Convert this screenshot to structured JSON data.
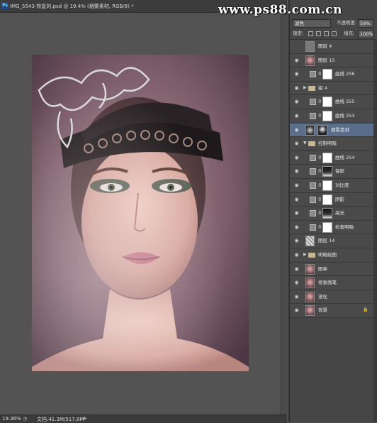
{
  "document": {
    "badge": "Ps",
    "tab_title": "IMG_5543-恢复的.psd @ 19.4% (烟雾素材, RGB/8) *",
    "tab_close": "×"
  },
  "status": {
    "zoom": "19.36%",
    "doc_info": "文档:41.3M/517.8M",
    "info_glyph": "◔",
    "arrow_glyph": "▶"
  },
  "watermark": "www.ps88.com.cn",
  "options": {
    "blend_mode": "滤色",
    "opacity_label": "不透明度:",
    "opacity_value": "59%",
    "lock_label": "锁定:",
    "fill_label": "填充:",
    "fill_value": "100%"
  },
  "layers": [
    {
      "name": "图层 4",
      "kind": "layer"
    },
    {
      "name": "图层 15",
      "kind": "layer"
    },
    {
      "name": "曲线 256",
      "kind": "adjust"
    },
    {
      "name": "组 4",
      "kind": "group"
    },
    {
      "name": "曲线 255",
      "kind": "adjust"
    },
    {
      "name": "曲线 253",
      "kind": "adjust"
    },
    {
      "name": "烟雾素材",
      "kind": "layer",
      "selected": true
    },
    {
      "name": "控制明暗",
      "kind": "group-open"
    },
    {
      "name": "曲线 254",
      "kind": "adjust"
    },
    {
      "name": "保密",
      "kind": "adjust"
    },
    {
      "name": "对比度",
      "kind": "adjust"
    },
    {
      "name": "阴影",
      "kind": "adjust"
    },
    {
      "name": "高光",
      "kind": "adjust"
    },
    {
      "name": "检查明暗",
      "kind": "adjust"
    },
    {
      "name": "图层 14",
      "kind": "layer"
    },
    {
      "name": "明暗绘图",
      "kind": "group"
    },
    {
      "name": "图章",
      "kind": "layer"
    },
    {
      "name": "修复画笔",
      "kind": "layer"
    },
    {
      "name": "液化",
      "kind": "layer"
    },
    {
      "name": "背景",
      "kind": "background"
    }
  ],
  "colors": {
    "selected": "#5a6e8c",
    "panel": "#464646",
    "workspace": "#535353"
  }
}
